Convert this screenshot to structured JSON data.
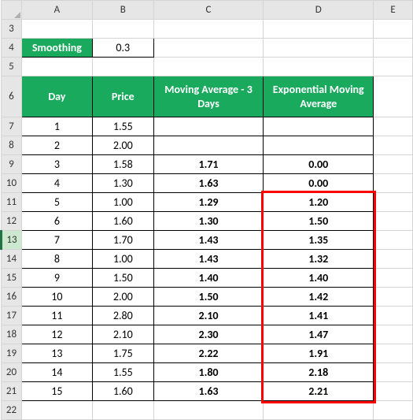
{
  "columns": {
    "rh": "",
    "a": "A",
    "b": "B",
    "c": "C",
    "d": "D",
    "e": "E"
  },
  "row_labels": {
    "r3": "3",
    "r4": "4",
    "r5": "5",
    "r6": "6",
    "r7": "7",
    "r8": "8",
    "r9": "9",
    "r10": "10",
    "r11": "11",
    "r12": "12",
    "r13": "13",
    "r14": "14",
    "r15": "15",
    "r16": "16",
    "r17": "17",
    "r18": "18",
    "r19": "19",
    "r20": "20",
    "r21": "21",
    "r22": "22"
  },
  "smoothing": {
    "label": "Smoothing",
    "value": "0.3"
  },
  "headers": {
    "day": "Day",
    "price": "Price",
    "ma": "Moving Average - 3 Days",
    "ema": "Exponential Moving Average"
  },
  "chart_data": {
    "type": "table",
    "columns": [
      "Day",
      "Price",
      "Moving Average - 3 Days",
      "Exponential Moving Average"
    ],
    "rows": [
      {
        "day": "1",
        "price": "1.55",
        "ma": "",
        "ema": ""
      },
      {
        "day": "2",
        "price": "2.00",
        "ma": "",
        "ema": ""
      },
      {
        "day": "3",
        "price": "1.58",
        "ma": "1.71",
        "ema": "0.00"
      },
      {
        "day": "4",
        "price": "1.30",
        "ma": "1.63",
        "ema": "0.00"
      },
      {
        "day": "5",
        "price": "1.00",
        "ma": "1.29",
        "ema": "1.20"
      },
      {
        "day": "6",
        "price": "1.60",
        "ma": "1.30",
        "ema": "1.50"
      },
      {
        "day": "7",
        "price": "1.70",
        "ma": "1.43",
        "ema": "1.35"
      },
      {
        "day": "8",
        "price": "1.00",
        "ma": "1.43",
        "ema": "1.32"
      },
      {
        "day": "9",
        "price": "1.50",
        "ma": "1.40",
        "ema": "1.40"
      },
      {
        "day": "10",
        "price": "2.00",
        "ma": "1.50",
        "ema": "1.42"
      },
      {
        "day": "11",
        "price": "2.80",
        "ma": "2.10",
        "ema": "1.41"
      },
      {
        "day": "12",
        "price": "2.10",
        "ma": "2.30",
        "ema": "1.47"
      },
      {
        "day": "13",
        "price": "1.75",
        "ma": "2.22",
        "ema": "1.91"
      },
      {
        "day": "14",
        "price": "1.55",
        "ma": "1.80",
        "ema": "2.18"
      },
      {
        "day": "15",
        "price": "1.60",
        "ma": "1.63",
        "ema": "2.21"
      }
    ]
  }
}
